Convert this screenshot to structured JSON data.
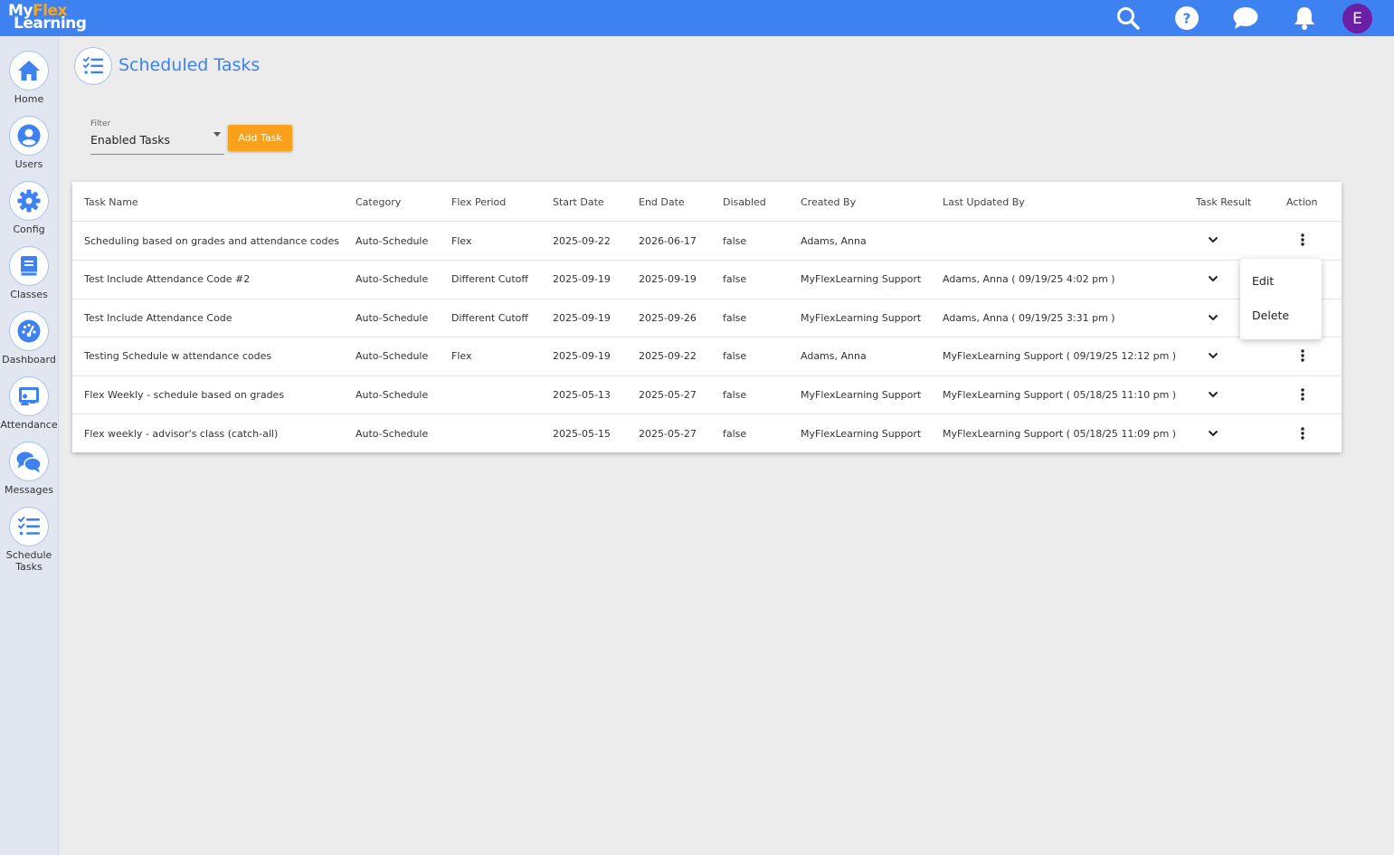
{
  "header": {
    "logo_line1_a": "My",
    "logo_line1_b": "Flex",
    "logo_line2": "Learning",
    "icons": [
      "search-icon",
      "help-icon",
      "chat-icon",
      "bell-icon"
    ],
    "avatar_letter": "E",
    "colors": {
      "bar": "#3d82f0",
      "avatar": "#6a1fa5",
      "logo_accent": "#f5a623"
    }
  },
  "sidebar": {
    "items": [
      {
        "label": "Home",
        "icon": "home-icon"
      },
      {
        "label": "Users",
        "icon": "user-icon"
      },
      {
        "label": "Config",
        "icon": "gear-icon"
      },
      {
        "label": "Classes",
        "icon": "book-icon"
      },
      {
        "label": "Dashboard",
        "icon": "gauge-icon"
      },
      {
        "label": "Attendance",
        "icon": "presentation-icon"
      },
      {
        "label": "Messages",
        "icon": "messages-icon"
      },
      {
        "label": "Schedule",
        "label2": "Tasks",
        "icon": "task-list-icon"
      }
    ]
  },
  "page": {
    "title": "Scheduled Tasks",
    "filter_label": "Filter",
    "filter_value": "Enabled Tasks",
    "add_button": "Add Task",
    "accent_button": "#f9a11b"
  },
  "table": {
    "columns": [
      "Task Name",
      "Category",
      "Flex Period",
      "Start Date",
      "End Date",
      "Disabled",
      "Created By",
      "Last Updated By",
      "Task Result",
      "Action"
    ],
    "rows": [
      [
        "Scheduling based on grades and attendance codes",
        "Auto-Schedule",
        "Flex",
        "2025-09-22",
        "2026-06-17",
        "false",
        "Adams, Anna",
        ""
      ],
      [
        "Test Include Attendance Code #2",
        "Auto-Schedule",
        "Different Cutoff",
        "2025-09-19",
        "2025-09-19",
        "false",
        "MyFlexLearning Support",
        "Adams, Anna ( 09/19/25 4:02 pm )"
      ],
      [
        "Test Include Attendance Code",
        "Auto-Schedule",
        "Different Cutoff",
        "2025-09-19",
        "2025-09-26",
        "false",
        "MyFlexLearning Support",
        "Adams, Anna ( 09/19/25 3:31 pm )"
      ],
      [
        "Testing Schedule w attendance codes",
        "Auto-Schedule",
        "Flex",
        "2025-09-19",
        "2025-09-22",
        "false",
        "Adams, Anna",
        "MyFlexLearning Support ( 09/19/25 12:12 pm )"
      ],
      [
        "Flex Weekly - schedule based on grades",
        "Auto-Schedule",
        "",
        "2025-05-13",
        "2025-05-27",
        "false",
        "MyFlexLearning Support",
        "MyFlexLearning Support ( 05/18/25 11:10 pm )"
      ],
      [
        "Flex weekly - advisor's class (catch-all)",
        "Auto-Schedule",
        "",
        "2025-05-15",
        "2025-05-27",
        "false",
        "MyFlexLearning Support",
        "MyFlexLearning Support ( 05/18/25 11:09 pm )"
      ]
    ]
  },
  "context_menu": {
    "items": [
      "Edit",
      "Delete"
    ]
  }
}
